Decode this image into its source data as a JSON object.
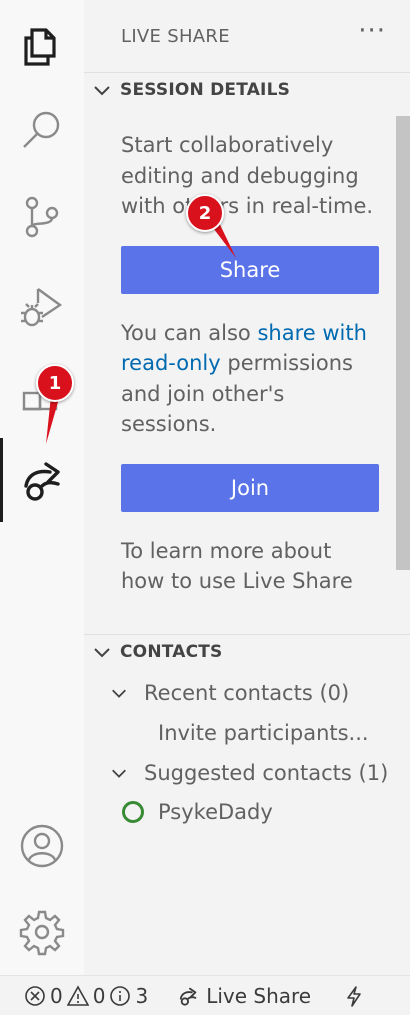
{
  "sidebar": {
    "title": "LIVE SHARE",
    "more": "···"
  },
  "session_details": {
    "header": "SESSION DETAILS",
    "intro": "Start collaboratively editing and debugging with others in real-time.",
    "share_label": "Share",
    "also_prefix": "You can also ",
    "also_link": "share with read-only",
    "also_suffix": " permissions and join other's sessions.",
    "join_label": "Join",
    "learn_more": "To learn more about how to use Live Share"
  },
  "contacts": {
    "header": "CONTACTS",
    "recent": "Recent contacts (0)",
    "invite": "Invite participants...",
    "suggested": "Suggested contacts (1)",
    "contact_name": "PsykeDady",
    "presence_color": "#388a34"
  },
  "annotations": {
    "badge_1": "1",
    "badge_2": "2",
    "badge_color": "#d9111c"
  },
  "status_bar": {
    "errors": "0",
    "warnings": "0",
    "infos": "3",
    "live_share": "Live Share"
  },
  "icons": {
    "activity": [
      "files-icon",
      "search-icon",
      "source-control-icon",
      "run-debug-icon",
      "extensions-icon",
      "live-share-icon"
    ],
    "bottom": [
      "account-icon",
      "settings-gear-icon"
    ]
  }
}
